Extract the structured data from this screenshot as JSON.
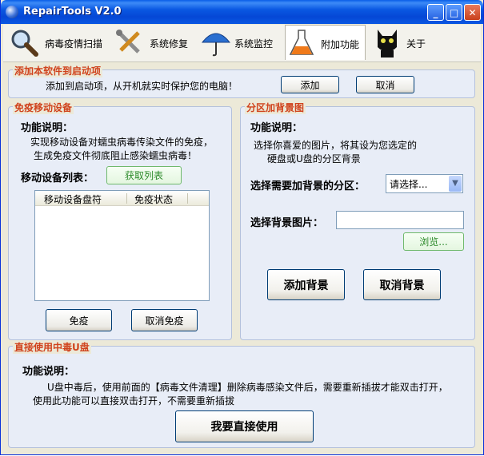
{
  "window": {
    "title": "RepairTools V2.0",
    "minimize": "_",
    "maximize": "□",
    "close": "✕"
  },
  "tabs": [
    {
      "label": "病毒疫情扫描",
      "icon": "magnifier-icon"
    },
    {
      "label": "系统修复",
      "icon": "tools-icon"
    },
    {
      "label": "系统监控",
      "icon": "umbrella-icon"
    },
    {
      "label": "附加功能",
      "icon": "flask-icon",
      "active": true
    },
    {
      "label": "关于",
      "icon": "cat-icon"
    }
  ],
  "startup": {
    "legend": "添加本软件到启动项",
    "desc": "添加到启动项，从开机就实时保护您的电脑！",
    "add": "添加",
    "cancel": "取消"
  },
  "immune": {
    "legend": "免疫移动设备",
    "func_label": "功能说明：",
    "desc1": "实现移动设备对蠕虫病毒传染文件的免疫，",
    "desc2": "生成免疫文件彻底阻止感染蠕虫病毒！",
    "list_label": "移动设备列表：",
    "fetch": "获取列表",
    "col1": "移动设备盘符",
    "col2": "免疫状态",
    "immune_btn": "免疫",
    "cancel_immune_btn": "取消免疫"
  },
  "bg": {
    "legend": "分区加背景图",
    "func_label": "功能说明：",
    "desc1": "选择你喜爱的图片，将其设为您选定的",
    "desc2": "硬盘或U盘的分区背景",
    "partition_label": "选择需要加背景的分区：",
    "partition_value": "请选择...",
    "image_label": "选择背景图片：",
    "image_value": "",
    "browse": "浏览...",
    "add_bg": "添加背景",
    "cancel_bg": "取消背景"
  },
  "usb": {
    "legend": "直接使用中毒U盘",
    "func_label": "功能说明：",
    "desc1": "U盘中毒后，使用前面的【病毒文件清理】删除病毒感染文件后，需要重新插拔才能双击打开，",
    "desc2": "使用此功能可以直接双击打开，不需要重新插拔",
    "use_btn": "我要直接使用"
  }
}
